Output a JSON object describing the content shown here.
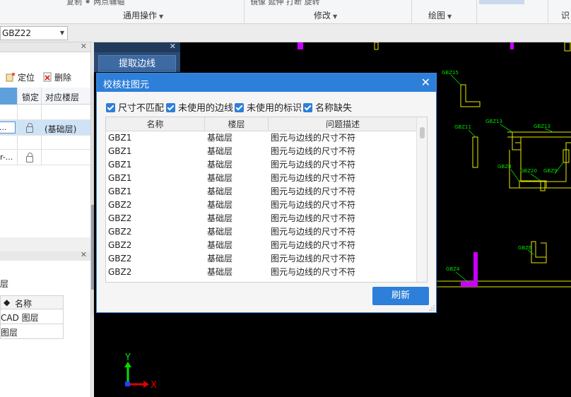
{
  "ribbon": {
    "groups": [
      {
        "label": "通用操作",
        "cut_text": "复制  ⁕ 两点辅轴"
      },
      {
        "label": "修改",
        "cut_text": "镜像  延伸  打断  旋转"
      },
      {
        "label": "绘图",
        "cut_text": ""
      },
      {
        "label": "识",
        "cut_text": ""
      }
    ]
  },
  "combo": {
    "value": "GBZ22"
  },
  "left_panel": {
    "toolbar": {
      "locate_label": "定位",
      "delete_label": "删除"
    },
    "grid": {
      "headers": [
        "锁定",
        "对应楼层"
      ],
      "rows": [
        {
          "name": "...",
          "floor": "(基础层)",
          "selected": true
        },
        {
          "name": "",
          "floor": ""
        },
        {
          "name": "r-...",
          "floor": ""
        }
      ]
    },
    "layer_section": {
      "title": "层",
      "header": "名称",
      "items": [
        "CAD 图层",
        "图层"
      ]
    }
  },
  "tool_panel": {
    "extract_label": "提取边线"
  },
  "dialog": {
    "title": "校核柱图元",
    "filters": [
      {
        "label": "尺寸不匹配",
        "checked": true
      },
      {
        "label": "未使用的边线",
        "checked": true
      },
      {
        "label": "未使用的标识",
        "checked": true
      },
      {
        "label": "名称缺失",
        "checked": true
      }
    ],
    "columns": [
      "名称",
      "楼层",
      "问题描述"
    ],
    "rows": [
      {
        "name": "GBZ1",
        "floor": "基础层",
        "desc": "图元与边线的尺寸不符"
      },
      {
        "name": "GBZ1",
        "floor": "基础层",
        "desc": "图元与边线的尺寸不符"
      },
      {
        "name": "GBZ1",
        "floor": "基础层",
        "desc": "图元与边线的尺寸不符"
      },
      {
        "name": "GBZ1",
        "floor": "基础层",
        "desc": "图元与边线的尺寸不符"
      },
      {
        "name": "GBZ1",
        "floor": "基础层",
        "desc": "图元与边线的尺寸不符"
      },
      {
        "name": "GBZ2",
        "floor": "基础层",
        "desc": "图元与边线的尺寸不符"
      },
      {
        "name": "GBZ2",
        "floor": "基础层",
        "desc": "图元与边线的尺寸不符"
      },
      {
        "name": "GBZ2",
        "floor": "基础层",
        "desc": "图元与边线的尺寸不符"
      },
      {
        "name": "GBZ2",
        "floor": "基础层",
        "desc": "图元与边线的尺寸不符"
      },
      {
        "name": "GBZ2",
        "floor": "基础层",
        "desc": "图元与边线的尺寸不符"
      },
      {
        "name": "GBZ2",
        "floor": "基础层",
        "desc": "图元与边线的尺寸不符"
      }
    ],
    "refresh_label": "刷新"
  },
  "canvas": {
    "axis": {
      "x": "X",
      "y": "Y"
    },
    "labels": [
      "GBZ15",
      "GBZ11",
      "GBZ13",
      "GBZ13",
      "GBZ8",
      "GBZ20",
      "GBZ9",
      "GBZ6",
      "GBZ4"
    ],
    "colors": {
      "background": "#000000",
      "outline": "#e8e800",
      "label": "#00e000",
      "highlight": "#c800ff"
    }
  }
}
